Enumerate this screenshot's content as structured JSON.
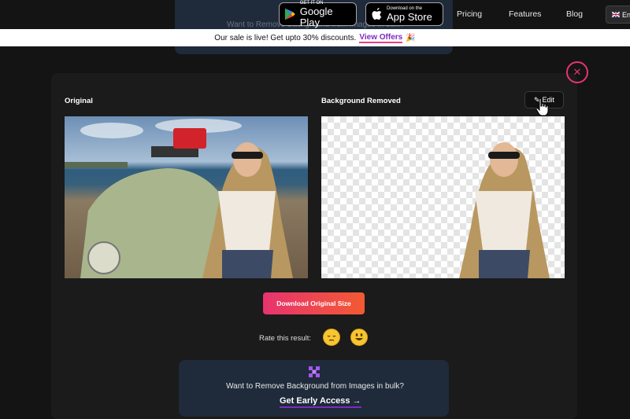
{
  "nav": {
    "ghost_text": "Want to Remove Background from Images in bulk?",
    "google_play": {
      "small": "GET IT ON",
      "big": "Google Play"
    },
    "app_store": {
      "small": "Download on the",
      "big": "App Store"
    },
    "links": [
      "Pricing",
      "Features",
      "Blog"
    ],
    "lang": "En"
  },
  "promo": {
    "text": "Our sale is live! Get upto 30% discounts.",
    "link": "View Offers",
    "emoji": "🎉"
  },
  "result": {
    "original_label": "Original",
    "removed_label": "Background Removed",
    "edit_label": "Edit",
    "download_label": "Download Original Size",
    "rate_label": "Rate this result:"
  },
  "bulk": {
    "text": "Want to Remove Background from Images in bulk?",
    "link": "Get Early Access →"
  },
  "colors": {
    "accent": "#e8336f",
    "purple": "#7b2cbf",
    "card": "#1f2a3a"
  }
}
